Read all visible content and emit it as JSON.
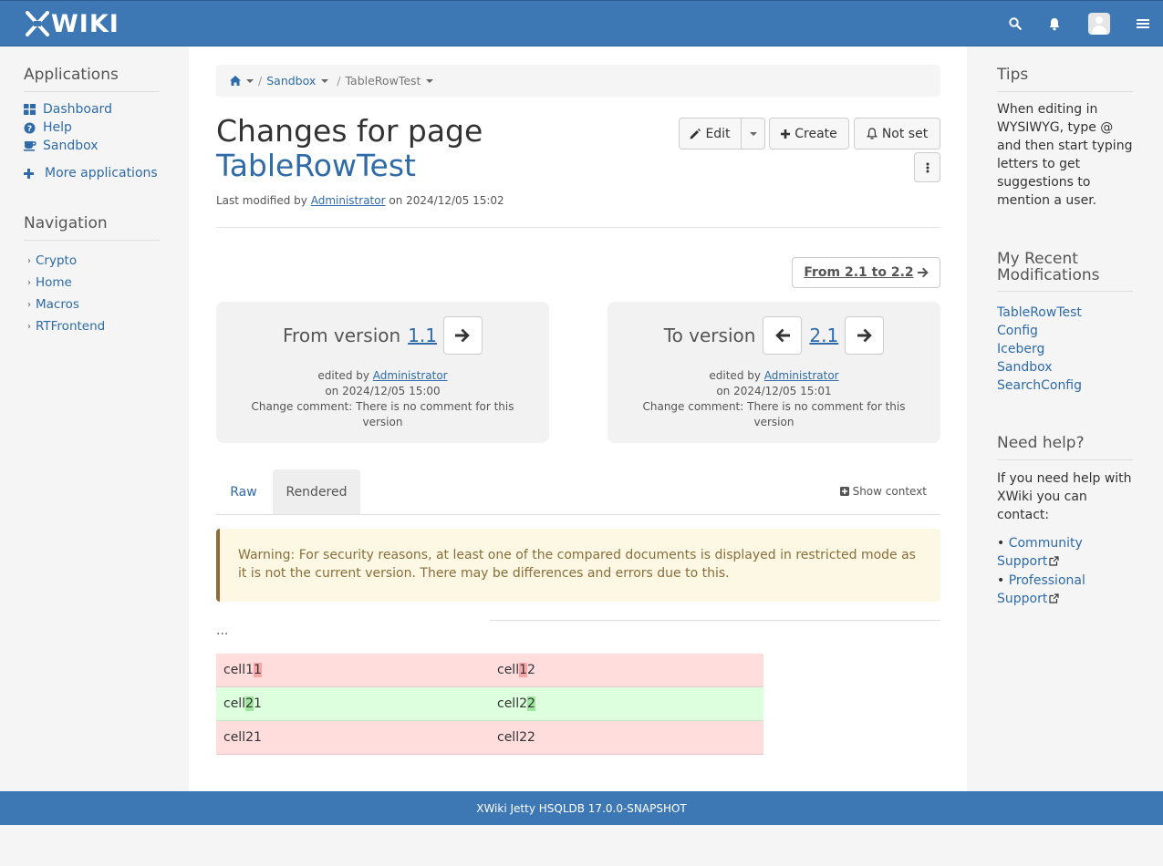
{
  "header": {
    "logo_text": "WIKI",
    "icons": [
      "search-icon",
      "bell-icon",
      "avatar",
      "menu-icon"
    ]
  },
  "left": {
    "applications_title": "Applications",
    "apps": [
      {
        "label": "Dashboard",
        "icon": "dashboard-icon"
      },
      {
        "label": "Help",
        "icon": "question-circle-icon"
      },
      {
        "label": "Sandbox",
        "icon": "coffee-icon"
      },
      {
        "label": "More applications",
        "icon": "plus-icon"
      }
    ],
    "navigation_title": "Navigation",
    "nav": [
      "Crypto",
      "Home",
      "Macros",
      "RTFrontend"
    ]
  },
  "breadcrumb": {
    "home_icon": "home-icon",
    "items": [
      "Sandbox",
      "TableRowTest"
    ],
    "separator": "/"
  },
  "page": {
    "title_prefix": "Changes for page",
    "title_doc": "TableRowTest",
    "meta_prefix": "Last modified by",
    "meta_user": "Administrator",
    "meta_suffix": "on 2024/12/05 15:02"
  },
  "actions": {
    "edit": "Edit",
    "create": "Create",
    "notify": "Not set"
  },
  "range": {
    "label": "From 2.1 to 2.2"
  },
  "from_version": {
    "label": "From version",
    "version": "1.1",
    "edited_by": "edited by",
    "user": "Administrator",
    "date": "on 2024/12/05 15:00",
    "comment": "Change comment: There is no comment for this version"
  },
  "to_version": {
    "label": "To version",
    "version": "2.1",
    "edited_by": "edited by",
    "user": "Administrator",
    "date": "on 2024/12/05 15:01",
    "comment": "Change comment: There is no comment for this version"
  },
  "tabs": {
    "raw": "Raw",
    "rendered": "Rendered",
    "active": "Rendered",
    "show_context": "Show context"
  },
  "warning": "Warning: For security reasons, at least one of the compared documents is displayed in restricted mode as it is not the current version. There may be differences and errors due to this.",
  "diff": {
    "ellipsis": "...",
    "rows": [
      {
        "type": "deleted",
        "cells": [
          {
            "pre": "cell1",
            "mark": "1",
            "post": ""
          },
          {
            "pre": "cell",
            "mark": "1",
            "post": "2"
          }
        ]
      },
      {
        "type": "inserted",
        "cells": [
          {
            "pre": "cell",
            "mark": "2",
            "post": "1"
          },
          {
            "pre": "cell2",
            "mark": "2",
            "post": ""
          }
        ]
      },
      {
        "type": "deleted",
        "cells": [
          {
            "pre": "cell21",
            "mark": "",
            "post": ""
          },
          {
            "pre": "cell22",
            "mark": "",
            "post": ""
          }
        ]
      }
    ]
  },
  "right": {
    "tips_title": "Tips",
    "tips_text": "When editing in WYSIWYG, type @ and then start typing letters to get suggestions to mention a user.",
    "recent_title": "My Recent Modifications",
    "recent": [
      "TableRowTest",
      "Config",
      "Iceberg",
      "Sandbox",
      "SearchConfig"
    ],
    "help_title": "Need help?",
    "help_text": "If you need help with XWiki you can contact:",
    "help_links": [
      "Community Support",
      "Professional Support"
    ]
  },
  "footer": {
    "text": "XWiki Jetty HSQLDB 17.0.0-SNAPSHOT"
  },
  "colors": {
    "brand": "#3d78b5",
    "link": "#2e6ba8",
    "deleted_bg": "#ffdddd",
    "inserted_bg": "#ddffdd",
    "warning_bg": "#fcf8e3"
  }
}
